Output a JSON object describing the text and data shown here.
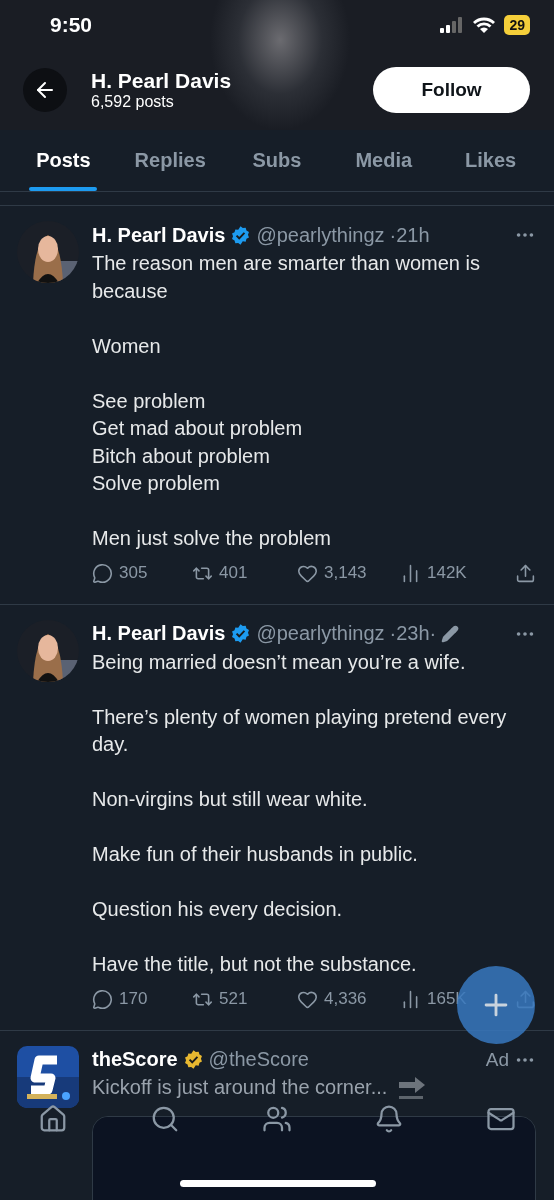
{
  "status_bar": {
    "time": "9:50",
    "battery": "29"
  },
  "profile": {
    "name": "H. Pearl Davis",
    "posts_count": "6,592 posts",
    "follow_button": "Follow"
  },
  "tabs": [
    {
      "label": "Posts",
      "selected": true
    },
    {
      "label": "Replies",
      "selected": false
    },
    {
      "label": "Subs",
      "selected": false
    },
    {
      "label": "Media",
      "selected": false
    },
    {
      "label": "Likes",
      "selected": false
    }
  ],
  "posts": [
    {
      "kind": "post",
      "author": "H. Pearl Davis",
      "color": "#1d9bf0",
      "handle": "@pearlythingz",
      "time": "·21h",
      "edited": false,
      "paragraphs": [
        "The reason men are smarter than women is because",
        "Women",
        "See problem\nGet mad about problem\nBitch about problem\nSolve problem",
        "Men just solve the problem"
      ],
      "stats": [
        {
          "kind": "reply",
          "value": "305"
        },
        {
          "kind": "repost",
          "value": "401"
        },
        {
          "kind": "like",
          "value": "3,143"
        },
        {
          "kind": "views",
          "value": "142K"
        },
        {
          "kind": "share"
        }
      ]
    },
    {
      "kind": "post",
      "author": "H. Pearl Davis",
      "color": "#1d9bf0",
      "handle": "@pearlythingz",
      "time": "·23h·",
      "edited": true,
      "paragraphs": [
        "Being married doesn’t mean you’re a wife.",
        "There’s plenty of women playing pretend every day.",
        "Non-virgins but still wear white.",
        "Make fun of their husbands in public.",
        "Question his every decision.",
        "Have the title, but not the substance."
      ],
      "stats": [
        {
          "kind": "reply",
          "value": "170"
        },
        {
          "kind": "repost",
          "value": "521"
        },
        {
          "kind": "like",
          "value": "4,336"
        },
        {
          "kind": "views",
          "value": "165K"
        },
        {
          "kind": "share"
        }
      ]
    },
    {
      "kind": "ad",
      "author": "theScore",
      "color": "#e8b830",
      "handle": "@theScore",
      "ad_label": "Ad",
      "paragraphs": [
        "Kickoff is just around the corner..."
      ]
    }
  ],
  "nav": [
    {
      "kind": "home"
    },
    {
      "kind": "search"
    },
    {
      "kind": "people"
    },
    {
      "kind": "notifications"
    },
    {
      "kind": "messages"
    }
  ]
}
